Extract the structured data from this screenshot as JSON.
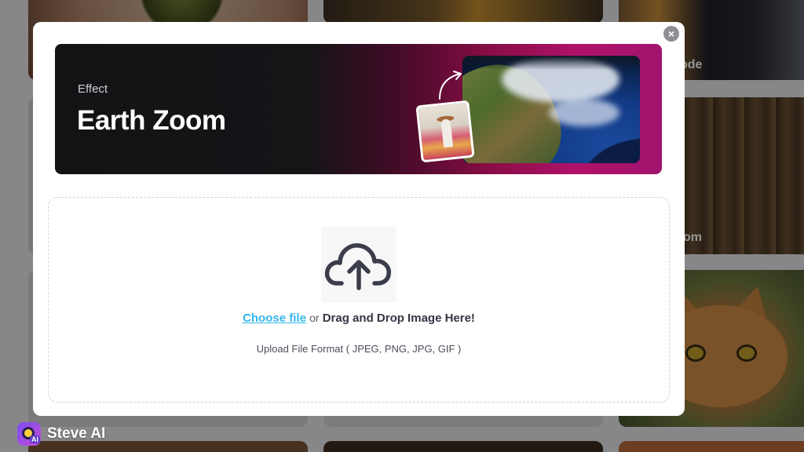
{
  "background": {
    "tile_labels": [
      "ode",
      "om"
    ]
  },
  "modal": {
    "banner": {
      "eyebrow": "Effect",
      "title": "Earth Zoom"
    },
    "close_icon": "close-icon",
    "dropzone": {
      "icon": "cloud-upload-icon",
      "choose_file_label": "Choose file",
      "or_label": "or",
      "drag_drop_label": "Drag and Drop Image Here!",
      "formats_label": "Upload File Format ( JPEG, PNG, JPG, GIF )"
    }
  },
  "watermark": {
    "label": "Steve AI",
    "badge": "AI"
  },
  "colors": {
    "link": "#35b7ea",
    "banner_dark": "#131316",
    "banner_magenta": "#b0126a",
    "icon_stroke": "#3b3d4a"
  }
}
